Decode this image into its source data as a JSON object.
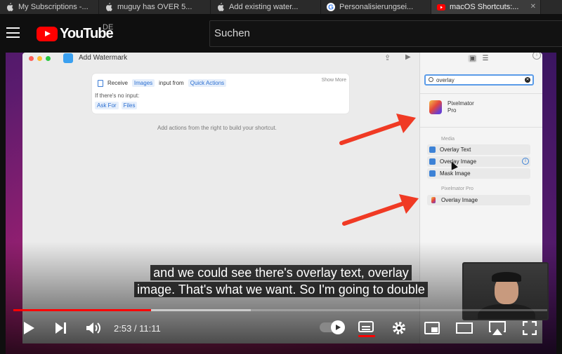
{
  "browser": {
    "tabs": [
      {
        "label": "My Subscriptions -...",
        "icon": "apple-icon",
        "active": false
      },
      {
        "label": "muguy has OVER 5...",
        "icon": "apple-icon",
        "active": false
      },
      {
        "label": "Add existing water...",
        "icon": "apple-icon",
        "active": false
      },
      {
        "label": "Personalisierungsei...",
        "icon": "google-icon",
        "active": false
      },
      {
        "label": "macOS Shortcuts:...",
        "icon": "youtube-icon",
        "active": true
      }
    ]
  },
  "youtube": {
    "logo_text": "YouTube",
    "country_code": "DE",
    "search_placeholder": "Suchen"
  },
  "shortcuts_window": {
    "title": "Add Watermark",
    "action_card": {
      "receive": "Receive",
      "images": "Images",
      "input_from": "input from",
      "quick_actions": "Quick Actions",
      "show_more": "Show More",
      "no_input": "If there's no input:",
      "ask_for": "Ask For",
      "files": "Files"
    },
    "hint": "Add actions from the right to build your shortcut.",
    "sidebar": {
      "search_value": "overlay",
      "app_result": "Pixelmator Pro",
      "media_header": "Media",
      "media_actions": [
        "Overlay Text",
        "Overlay Image",
        "Mask Image"
      ],
      "pixelmator_header": "Pixelmator Pro",
      "pixelmator_actions": [
        "Overlay Image"
      ]
    }
  },
  "subtitles": {
    "line1": "and we could see there's overlay text, overlay",
    "line2": "image. That's what we want. So I'm going to double"
  },
  "player": {
    "current_time": "2:53",
    "separator": " / ",
    "duration": "11:11",
    "played_fraction": 0.258,
    "loaded_fraction": 0.445
  },
  "colors": {
    "youtube_red": "#ff0000",
    "annotation_arrow": "#f03a24",
    "shortcuts_accent": "#2c6fd1"
  }
}
